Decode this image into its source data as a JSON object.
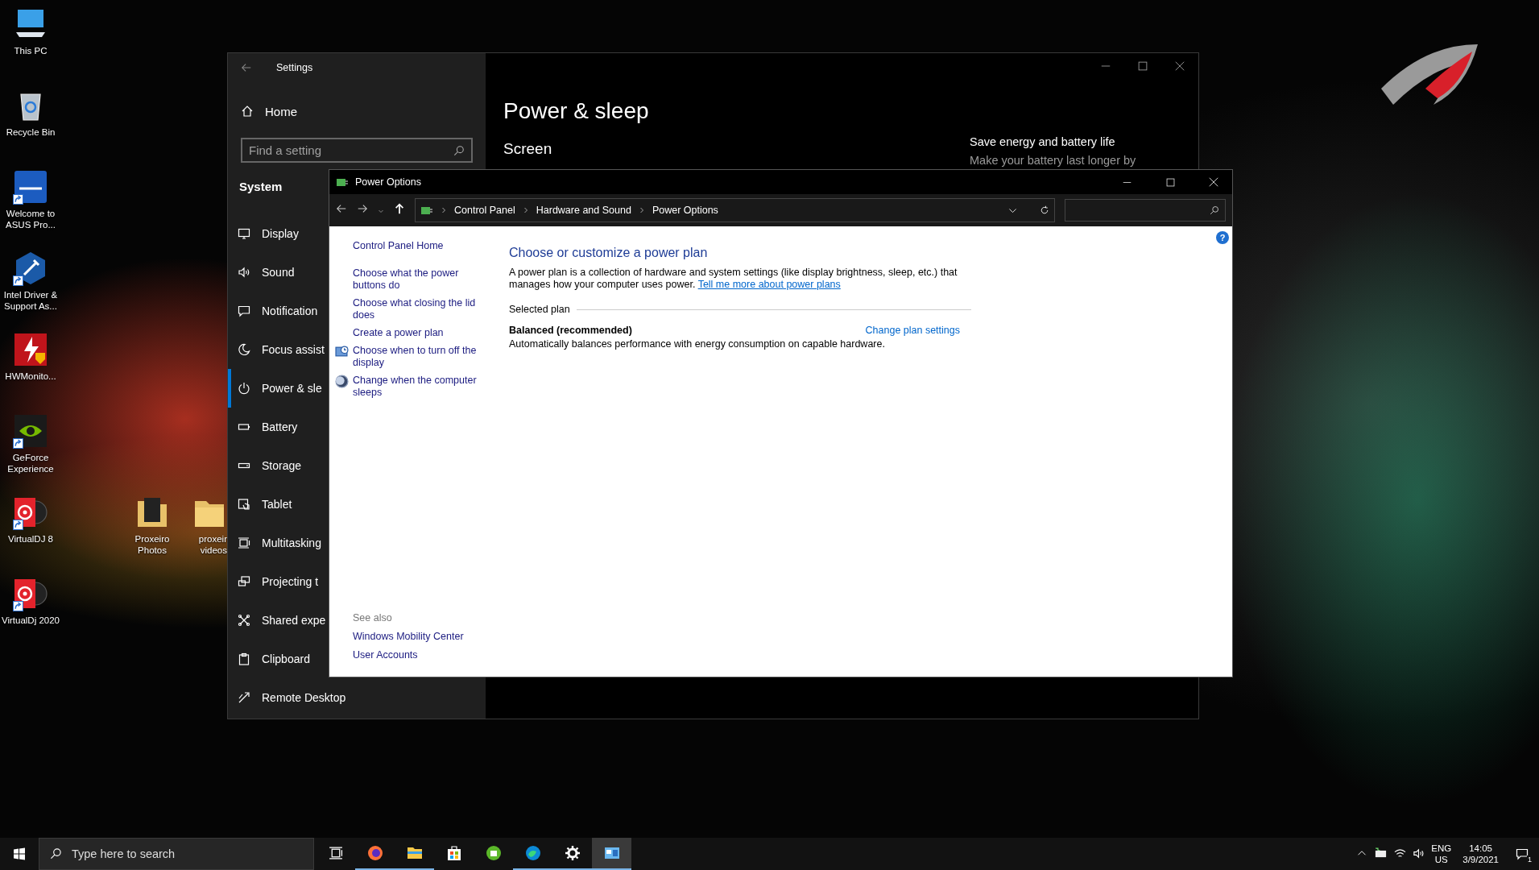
{
  "desktop_icons": [
    {
      "label": "This PC",
      "kind": "pc",
      "shortcut": false
    },
    {
      "label": "Recycle Bin",
      "kind": "recycle",
      "shortcut": false
    },
    {
      "label": "Welcome to ASUS Pro...",
      "kind": "asus",
      "shortcut": true
    },
    {
      "label": "Intel Driver & Support As...",
      "kind": "intel",
      "shortcut": true
    },
    {
      "label": "HWMonito...",
      "kind": "hwmonitor",
      "shortcut": false
    },
    {
      "label": "GeForce Experience",
      "kind": "nvidia",
      "shortcut": true
    },
    {
      "label": "VirtualDJ 8",
      "kind": "vdj",
      "shortcut": true
    },
    {
      "label": "VirtualDj 2020",
      "kind": "vdj",
      "shortcut": true
    }
  ],
  "desktop_folders": [
    {
      "label": "Proxeiro Photos",
      "kind": "photo-folder"
    },
    {
      "label": "proxeir videos",
      "kind": "folder"
    }
  ],
  "settings_window": {
    "title": "Settings",
    "home": "Home",
    "search": {
      "placeholder": "Find a setting"
    },
    "section": "System",
    "items": [
      {
        "label": "Display",
        "kind": "display",
        "selected": false
      },
      {
        "label": "Sound",
        "kind": "sound",
        "selected": false
      },
      {
        "label": "Notification",
        "kind": "notifications",
        "selected": false
      },
      {
        "label": "Focus assist",
        "kind": "moon",
        "selected": false
      },
      {
        "label": "Power & sle",
        "kind": "power",
        "selected": true
      },
      {
        "label": "Battery",
        "kind": "battery",
        "selected": false
      },
      {
        "label": "Storage",
        "kind": "storage",
        "selected": false
      },
      {
        "label": "Tablet",
        "kind": "tablet",
        "selected": false
      },
      {
        "label": "Multitasking",
        "kind": "multitasking",
        "selected": false
      },
      {
        "label": "Projecting t",
        "kind": "projecting",
        "selected": false
      },
      {
        "label": "Shared expe",
        "kind": "shared",
        "selected": false
      },
      {
        "label": "Clipboard",
        "kind": "clipboard",
        "selected": false
      },
      {
        "label": "Remote Desktop",
        "kind": "remote",
        "selected": false
      }
    ],
    "page_title": "Power & sleep",
    "subheading": "Screen",
    "aside": {
      "title": "Save energy and battery life",
      "text": "Make your battery last longer by"
    }
  },
  "power_options_window": {
    "title": "Power Options",
    "breadcrumb": [
      "Control Panel",
      "Hardware and Sound",
      "Power Options"
    ],
    "help_button": "?",
    "home_link": "Control Panel Home",
    "tasks": [
      {
        "label": "Choose what the power buttons do",
        "kind": "plain"
      },
      {
        "label": "Choose what closing the lid does",
        "kind": "plain"
      },
      {
        "label": "Create a power plan",
        "kind": "plain"
      },
      {
        "label": "Choose when to turn off the display",
        "kind": "monitor-clock"
      },
      {
        "label": "Change when the computer sleeps",
        "kind": "moon"
      }
    ],
    "see_also": {
      "title": "See also",
      "links": [
        "Windows Mobility Center",
        "User Accounts"
      ]
    },
    "heading": "Choose or customize a power plan",
    "description": "A power plan is a collection of hardware and system settings (like display brightness, sleep, etc.) that manages how your computer uses power.",
    "description_link": "Tell me more about power plans",
    "selected_plan": {
      "label": "Selected plan",
      "name": "Balanced (recommended)",
      "action": "Change plan settings",
      "description": "Automatically balances performance with energy consumption on capable hardware."
    }
  },
  "taskbar": {
    "search": {
      "placeholder": "Type here to search"
    },
    "apps": [
      {
        "kind": "task-view",
        "running": false,
        "active": false
      },
      {
        "kind": "firefox",
        "running": true,
        "active": false
      },
      {
        "kind": "explorer",
        "running": true,
        "active": false
      },
      {
        "kind": "store",
        "running": false,
        "active": false
      },
      {
        "kind": "green-app",
        "running": false,
        "active": false
      },
      {
        "kind": "edge",
        "running": true,
        "active": false
      },
      {
        "kind": "settings",
        "running": true,
        "active": false
      },
      {
        "kind": "control-panel",
        "running": true,
        "active": true
      }
    ],
    "tray": {
      "language": "ENG",
      "region": "US",
      "time": "14:05",
      "date": "3/9/2021",
      "notification_count": "1"
    }
  }
}
